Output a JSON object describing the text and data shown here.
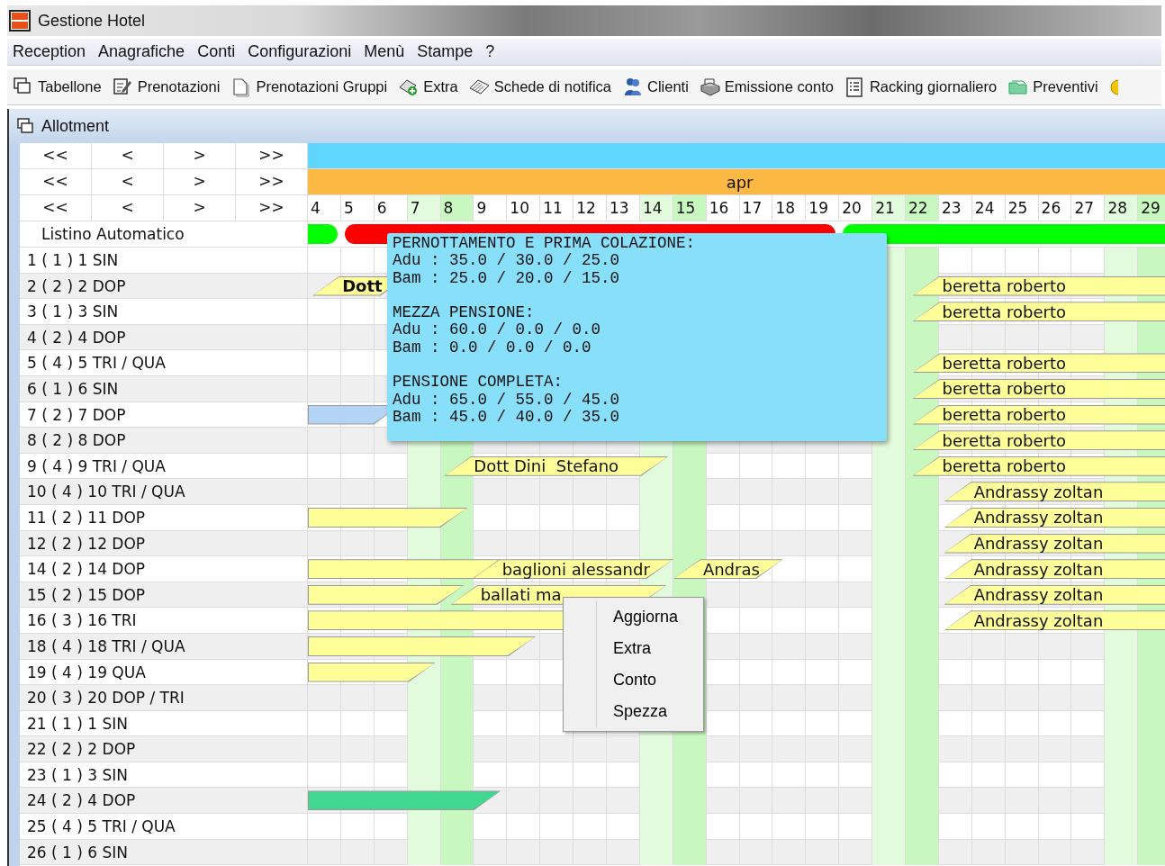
{
  "window": {
    "title": "Gestione Hotel"
  },
  "menu": [
    "Reception",
    "Anagrafiche",
    "Conti",
    "Configurazioni",
    "Menù",
    "Stampe",
    "?"
  ],
  "toolbar": [
    {
      "label": "Tabellone",
      "kind": "windows"
    },
    {
      "label": "Prenotazioni",
      "kind": "pencil"
    },
    {
      "label": "Prenotazioni Gruppi",
      "kind": "page"
    },
    {
      "label": "Extra",
      "kind": "plus"
    },
    {
      "label": "Schede di notifica",
      "kind": "cards"
    },
    {
      "label": "Clienti",
      "kind": "people"
    },
    {
      "label": "Emissione conto",
      "kind": "printer"
    },
    {
      "label": "Racking giornaliero",
      "kind": "list"
    },
    {
      "label": "Preventivi",
      "kind": "folder"
    },
    {
      "kind": "partial"
    }
  ],
  "panel": {
    "title": "Allotment"
  },
  "nav_rows": [
    {
      "buttons": [
        "<<",
        "<",
        ">",
        ">>"
      ]
    },
    {
      "buttons": [
        "<<",
        "<",
        ">",
        ">>"
      ],
      "month": "apr"
    },
    {
      "buttons": [
        "<<",
        "<",
        ">",
        ">>"
      ]
    }
  ],
  "price_list": {
    "label": "Listino Automatico"
  },
  "days": [
    {
      "label": "4",
      "kind": "weekday",
      "color": "#00ff00"
    },
    {
      "label": "5",
      "kind": "weekday",
      "color": "#ff0000"
    },
    {
      "label": "6",
      "kind": "weekday",
      "color": "#ff0000"
    },
    {
      "label": "7",
      "kind": "saturday",
      "color": "#ff0000"
    },
    {
      "label": "8",
      "kind": "sunday",
      "color": "#ff0000"
    },
    {
      "label": "9",
      "kind": "weekday",
      "color": "#ff0000"
    },
    {
      "label": "10",
      "kind": "weekday",
      "color": "#ff0000"
    },
    {
      "label": "11",
      "kind": "weekday",
      "color": "#ff0000"
    },
    {
      "label": "12",
      "kind": "weekday",
      "color": "#ff0000"
    },
    {
      "label": "13",
      "kind": "weekday",
      "color": "#ff0000"
    },
    {
      "label": "14",
      "kind": "saturday",
      "color": "#ff0000"
    },
    {
      "label": "15",
      "kind": "sunday",
      "color": "#ff0000"
    },
    {
      "label": "16",
      "kind": "weekday",
      "color": "#ff0000"
    },
    {
      "label": "17",
      "kind": "weekday",
      "color": "#ff0000"
    },
    {
      "label": "18",
      "kind": "weekday",
      "color": "#ff0000"
    },
    {
      "label": "19",
      "kind": "weekday",
      "color": "#ff0000"
    },
    {
      "label": "20",
      "kind": "weekday",
      "color": "#00ff00"
    },
    {
      "label": "21",
      "kind": "saturday",
      "color": "#00ff00"
    },
    {
      "label": "22",
      "kind": "sunday",
      "color": "#00ff00"
    },
    {
      "label": "23",
      "kind": "weekday",
      "color": "#00ff00"
    },
    {
      "label": "24",
      "kind": "weekday",
      "color": "#00ff00"
    },
    {
      "label": "25",
      "kind": "weekday",
      "color": "#00ff00"
    },
    {
      "label": "26",
      "kind": "weekday",
      "color": "#00ff00"
    },
    {
      "label": "27",
      "kind": "weekday",
      "color": "#00ff00"
    },
    {
      "label": "28",
      "kind": "saturday",
      "color": "#00ff00"
    },
    {
      "label": "29",
      "kind": "sunday",
      "color": "#00ff00"
    }
  ],
  "rooms": [
    {
      "label": "1 ( 1 ) 1 SIN"
    },
    {
      "label": "2 ( 2 ) 2 DOP",
      "bookings": [
        {
          "guest": "Dott",
          "color": "#ffff99",
          "bold": true
        },
        {
          "guest": "beretta roberto",
          "color": "#ffff99"
        }
      ]
    },
    {
      "label": "3 ( 1 ) 3 SIN",
      "bookings": [
        {
          "guest": "beretta roberto",
          "color": "#ffff99"
        }
      ]
    },
    {
      "label": "4 ( 2 ) 4 DOP"
    },
    {
      "label": "5 ( 4 ) 5 TRI / QUA",
      "bookings": [
        {
          "guest": "beretta roberto",
          "color": "#ffff99"
        }
      ]
    },
    {
      "label": "6 ( 1 ) 6 SIN",
      "bookings": [
        {
          "guest": "beretta roberto",
          "color": "#ffff99"
        }
      ]
    },
    {
      "label": "7 ( 2 ) 7 DOP",
      "bookings": [
        {
          "color": "#b3d4f5",
          "continues_left": true
        },
        {
          "guest": "beretta roberto",
          "color": "#ffff99"
        }
      ]
    },
    {
      "label": "8 ( 2 ) 8 DOP",
      "bookings": [
        {
          "guest": "beretta roberto",
          "color": "#ffff99"
        }
      ]
    },
    {
      "label": "9 ( 4 ) 9 TRI / QUA",
      "bookings": [
        {
          "guest": "Dott Dini  Stefano",
          "color": "#ffff99"
        },
        {
          "guest": "beretta roberto",
          "color": "#ffff99"
        }
      ]
    },
    {
      "label": "10 ( 4 ) 10 TRI / QUA",
      "bookings": [
        {
          "guest": "Andrassy zoltan",
          "color": "#ffff99"
        }
      ]
    },
    {
      "label": "11 ( 2 ) 11 DOP",
      "bookings": [
        {
          "color": "#ffff99",
          "continues_left": true
        },
        {
          "guest": "Andrassy zoltan",
          "color": "#ffff99"
        }
      ]
    },
    {
      "label": "12 ( 2 ) 12 DOP",
      "bookings": [
        {
          "guest": "Andrassy zoltan",
          "color": "#ffff99"
        }
      ]
    },
    {
      "label": "14 ( 2 ) 14 DOP",
      "bookings": [
        {
          "color": "#ffff99",
          "continues_left": true
        },
        {
          "guest": "baglioni alessandr",
          "color": "#ffff99"
        },
        {
          "guest": "Andras",
          "color": "#ffff99"
        },
        {
          "guest": "Andrassy zoltan",
          "color": "#ffff99"
        }
      ]
    },
    {
      "label": "15 ( 2 ) 15 DOP",
      "bookings": [
        {
          "color": "#ffff99",
          "continues_left": true
        },
        {
          "guest": "ballati ma",
          "color": "#ffff99"
        },
        {
          "guest": "Andrassy zoltan",
          "color": "#ffff99"
        }
      ]
    },
    {
      "label": "16 ( 3 ) 16 TRI",
      "bookings": [
        {
          "color": "#ffff99",
          "continues_left": true
        },
        {
          "guest": "Andrassy zoltan",
          "color": "#ffff99"
        }
      ]
    },
    {
      "label": "18 ( 4 ) 18 TRI / QUA",
      "bookings": [
        {
          "color": "#ffff99",
          "continues_left": true
        }
      ]
    },
    {
      "label": "19 ( 4 ) 19 QUA",
      "bookings": [
        {
          "color": "#ffff99",
          "continues_left": true
        }
      ]
    },
    {
      "label": "20 ( 3 ) 20 DOP / TRI"
    },
    {
      "label": "21 ( 1 ) 1 SIN"
    },
    {
      "label": "22 ( 2 ) 2 DOP"
    },
    {
      "label": "23 ( 1 ) 3 SIN"
    },
    {
      "label": "24 ( 2 ) 4 DOP",
      "bookings": [
        {
          "color": "#40d890",
          "continues_left": true
        }
      ]
    },
    {
      "label": "25 ( 4 ) 5 TRI / QUA"
    },
    {
      "label": "26 ( 1 ) 6 SIN"
    }
  ],
  "tooltip": {
    "sections": [
      {
        "heading": "PERNOTTAMENTO E PRIMA COLAZIONE:",
        "lines": [
          "Adu : 35.0 / 30.0 / 25.0",
          "Bam : 25.0 / 20.0 / 15.0"
        ]
      },
      {
        "heading": "MEZZA PENSIONE:",
        "lines": [
          "Adu : 60.0 / 0.0 / 0.0",
          "Bam : 0.0 / 0.0 / 0.0"
        ]
      },
      {
        "heading": "PENSIONE COMPLETA:",
        "lines": [
          "Adu : 65.0 / 55.0 / 45.0",
          "Bam : 45.0 / 40.0 / 35.0"
        ]
      }
    ]
  },
  "context_menu": [
    "Aggiorna",
    "Extra",
    "Conto",
    "Spezza"
  ]
}
